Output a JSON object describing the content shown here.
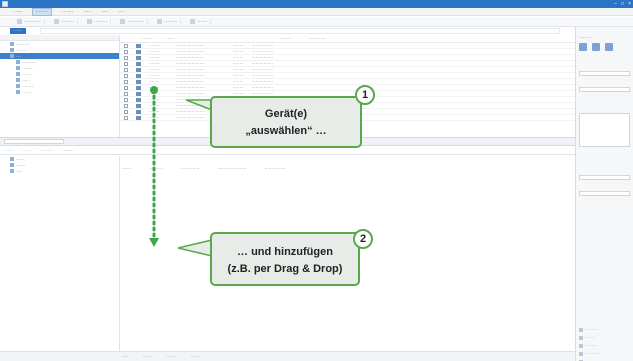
{
  "window": {
    "title": "",
    "controls": [
      "–",
      "□",
      "×"
    ]
  },
  "menubar": {
    "items": [
      "",
      "",
      "",
      "",
      "",
      ""
    ]
  },
  "toolbar": {
    "items": [
      "",
      "",
      "",
      "",
      "",
      ""
    ]
  },
  "tree": {
    "items": [
      "",
      "",
      "",
      "",
      "",
      "",
      "",
      "",
      ""
    ]
  },
  "devices": {
    "headers": [
      "",
      "",
      "",
      ""
    ],
    "rows": 13
  },
  "callouts": {
    "step1_number": "1",
    "step1_line1": "Gerät(e)",
    "step1_line2": "„auswählen“ …",
    "step2_number": "2",
    "step2_line1": "… und hinzufügen",
    "step2_line2": "(z.B. per Drag & Drop)"
  },
  "colors": {
    "accent": "#2b73c4",
    "callout_border": "#5aa84a",
    "callout_fill": "#e8ece8",
    "arrow": "#3aa848"
  }
}
